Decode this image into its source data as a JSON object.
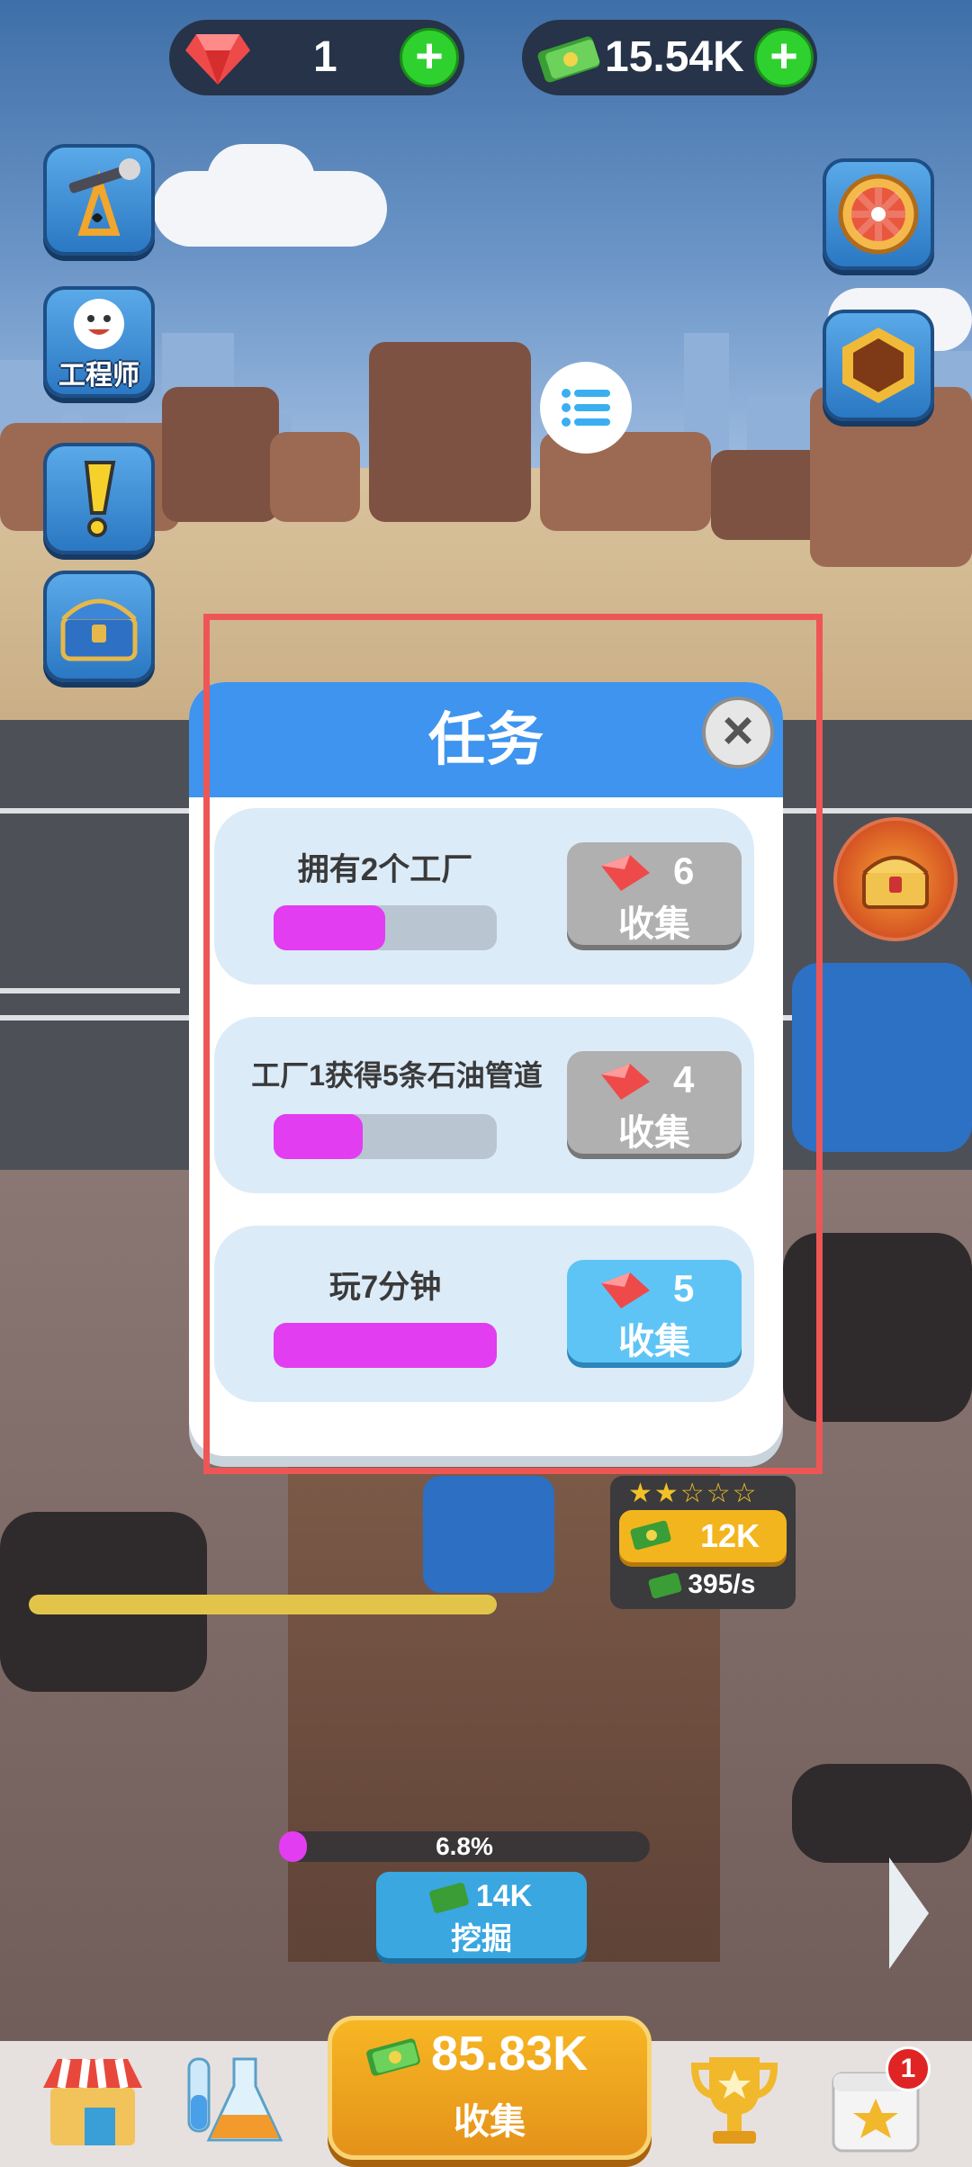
{
  "top_bar": {
    "gems": "1",
    "cash": "15.54K"
  },
  "side_buttons": {
    "engineer_label": "工程师"
  },
  "dialog": {
    "title": "任务",
    "tasks": [
      {
        "name": "拥有2个工厂",
        "reward": "6",
        "collect_label": "收集",
        "progress": 0.5,
        "claimable": false
      },
      {
        "name": "工厂1获得5条石油管道",
        "reward": "4",
        "collect_label": "收集",
        "progress": 0.4,
        "claimable": false
      },
      {
        "name": "玩7分钟",
        "reward": "5",
        "collect_label": "收集",
        "progress": 1.0,
        "claimable": true
      }
    ]
  },
  "factory": {
    "stars": "★★☆☆☆",
    "cost": "12K",
    "rate": "395/s"
  },
  "dig": {
    "progress_text": "6.8%",
    "progress": 0.068,
    "cost": "14K",
    "label": "挖掘"
  },
  "bottom_bar": {
    "collect_amount": "85.83K",
    "collect_label": "收集",
    "calendar_badge": "1"
  },
  "colors": {
    "accent_blue": "#3e94ee",
    "progress_magenta": "#e23df0",
    "highlight_red": "#ee5656",
    "collect_orange": "#f7b623"
  },
  "icons": [
    "gem-icon",
    "cash-icon",
    "plus-icon",
    "oil-pump-icon",
    "engineer-icon",
    "exclamation-icon",
    "treasure-chest-icon",
    "prize-wheel-icon",
    "hexagon-icon",
    "menu-icon",
    "close-icon",
    "shop-icon",
    "lab-flask-icon",
    "trophy-icon",
    "calendar-star-icon"
  ]
}
